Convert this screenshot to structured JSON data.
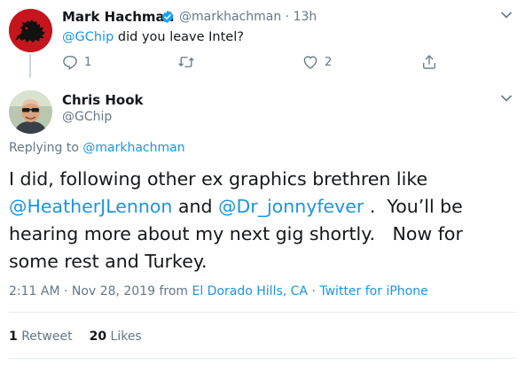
{
  "parent_tweet": {
    "author_name": "Mark Hachman",
    "author_handle": "@markhachman",
    "separator": "·",
    "time": "13h",
    "mention": "@GChip",
    "text": " did you leave Intel?",
    "reply_count": "1",
    "retweet_count": "",
    "like_count": "2",
    "verified": true
  },
  "main_tweet": {
    "author_name": "Chris Hook",
    "author_handle": "@GChip",
    "replying_label": "Replying to ",
    "replying_to": "@markhachman",
    "body_1": "I did, following other ex graphics brethren like\n",
    "mention_1": "@HeatherJLennon",
    "body_2": " and ",
    "mention_2": "@Dr_jonnyfever",
    "body_3": " .  You’ll be\nhearing more about my next gig shortly.   Now for\nsome rest and Turkey.",
    "time": "2:11 AM · Nov 28, 2019 from ",
    "location": "El Dorado Hills, CA",
    "dot": " · ",
    "source": "Twitter for iPhone",
    "retweets_count": "1",
    "retweets_label": "Retweet",
    "likes_count": "20",
    "likes_label": "Likes"
  },
  "colors": {
    "link": "#1b95e0",
    "muted": "#657786",
    "text": "#14171a",
    "verified": "#1da1f2",
    "avatar_red": "#c4161c"
  },
  "icons": {
    "verified": "verified-badge-icon",
    "caret": "chevron-down-icon",
    "reply": "reply-icon",
    "retweet": "retweet-icon",
    "like": "heart-icon",
    "share": "share-icon"
  }
}
